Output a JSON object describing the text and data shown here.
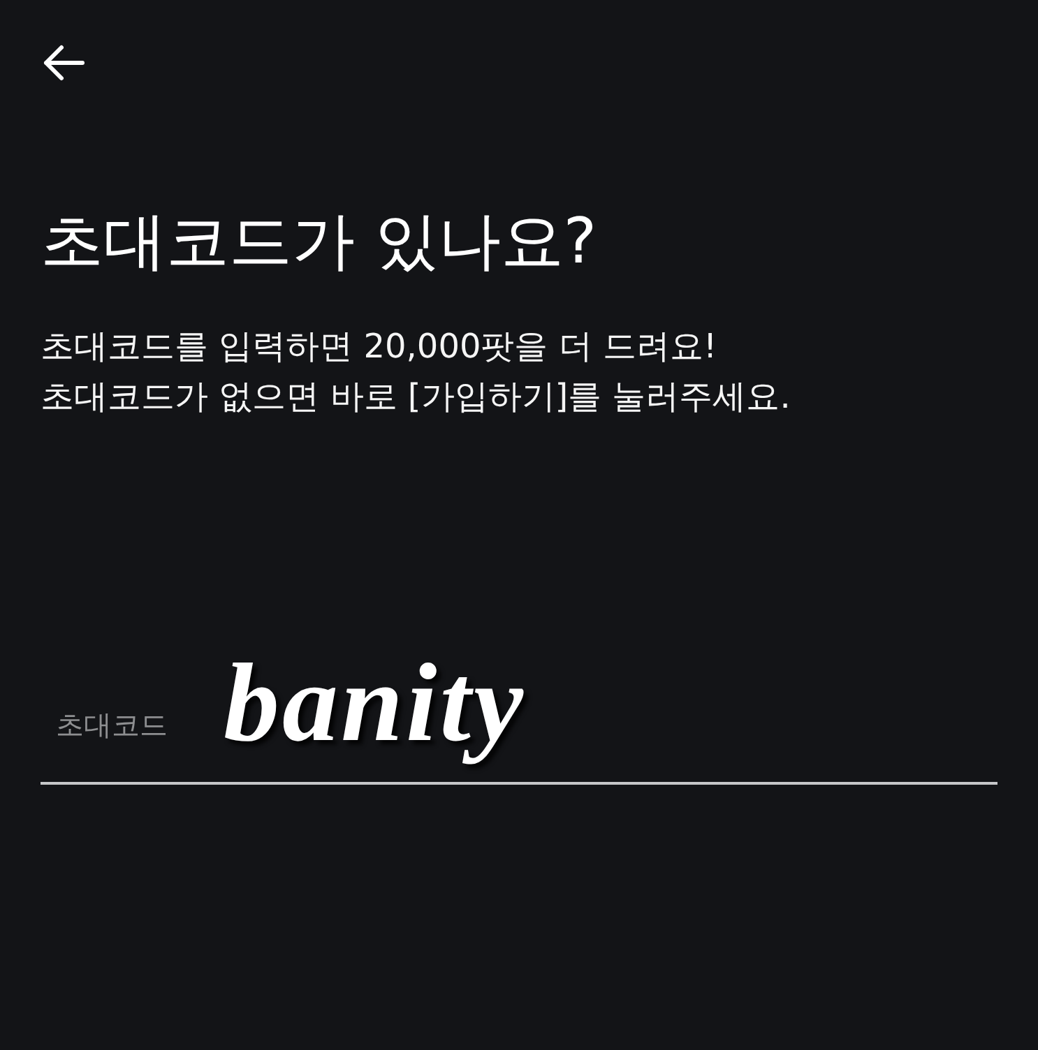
{
  "title": "초대코드가 있나요?",
  "description": [
    "초대코드를 입력하면 20,000팟을 더 드려요!",
    "초대코드가 없으면 바로 [가입하기]를 눌러주세요."
  ],
  "invite_code_field": {
    "label": "초대코드",
    "value": "banity"
  }
}
